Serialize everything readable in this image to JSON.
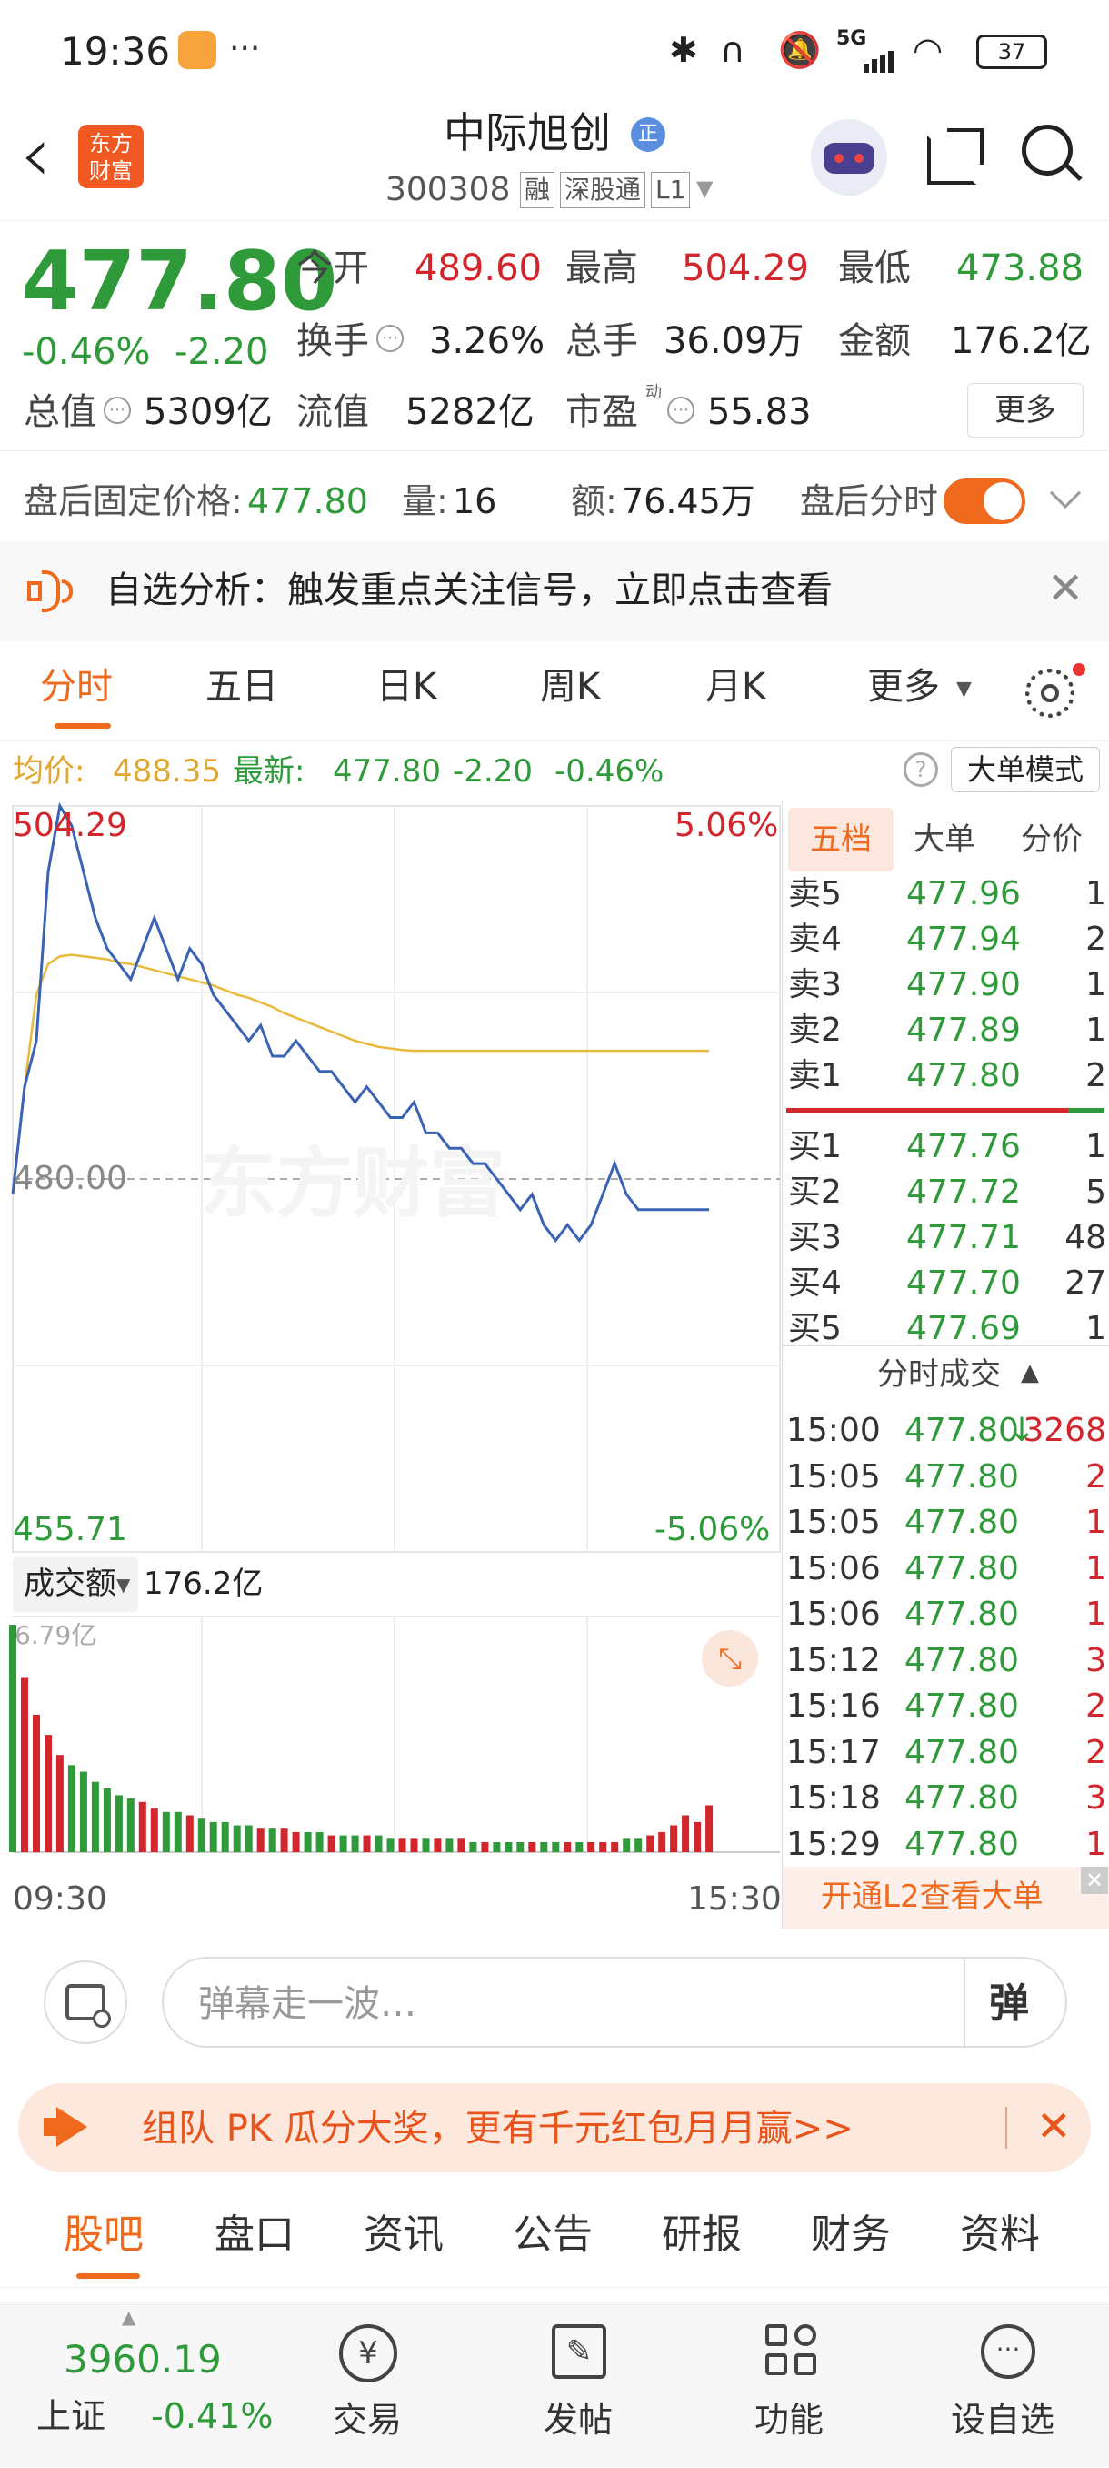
{
  "status_bar": {
    "time": "19:36",
    "more": "···",
    "signal": "5G",
    "battery": "37"
  },
  "header": {
    "back": "‹",
    "logo_line1": "东方",
    "logo_line2": "财富",
    "stock_name": "中际旭创",
    "badge": "正",
    "code": "300308",
    "tag_margin": "融",
    "tag_connect": "深股通",
    "tag_level": "L1"
  },
  "quote": {
    "price": "477.80",
    "change_pct": "-0.46%",
    "change": "-2.20",
    "open_label": "今开",
    "open": "489.60",
    "high_label": "最高",
    "high": "504.29",
    "low_label": "最低",
    "low": "473.88",
    "turnover_label": "换手",
    "turnover": "3.26%",
    "volume_label": "总手",
    "volume": "36.09万",
    "amount_label": "金额",
    "amount": "176.2亿",
    "mcap_label": "总值",
    "mcap": "5309亿",
    "float_label": "流值",
    "float": "5282亿",
    "pe_label": "市盈",
    "pe_sup": "动",
    "pe": "55.83",
    "more_button": "更多"
  },
  "after_hours": {
    "price_label": "盘后固定价格:",
    "price": "477.80",
    "vol_label": "量:",
    "vol": "16",
    "amt_label": "额:",
    "amt": "76.45万",
    "toggle_label": "盘后分时",
    "toggle_on": true
  },
  "notice": {
    "text": "自选分析：触发重点关注信号，立即点击查看"
  },
  "chart_tabs": [
    "分时",
    "五日",
    "日K",
    "周K",
    "月K",
    "更多"
  ],
  "active_chart_tab": 0,
  "info_line": {
    "avg_label": "均价:",
    "avg": "488.35",
    "latest_label": "最新:",
    "latest": "477.80",
    "change": "-2.20",
    "change_pct": "-0.46%",
    "help": "?",
    "mode_button": "大单模式"
  },
  "chart_labels": {
    "top_price": "504.29",
    "top_pct": "5.06%",
    "mid_price": "480.00",
    "bottom_price": "455.71",
    "bottom_pct": "-5.06%",
    "watermark": "东方财富",
    "amount_selector": "成交额",
    "amount_total": "176.2亿",
    "vol_max": "6.79亿",
    "time_start": "09:30",
    "time_end": "15:30"
  },
  "chart_data": {
    "type": "line",
    "x_range": [
      "09:30",
      "15:00"
    ],
    "ylim": [
      455.71,
      504.29
    ],
    "prev_close": 480.0,
    "series": [
      {
        "name": "",
        "color": "#3a63b5",
        "values": [
          479,
          486,
          489,
          500,
          504.29,
          503,
          500,
          497,
          495,
          494,
          493,
          495,
          497,
          495,
          493,
          495,
          494,
          492,
          491,
          490,
          489,
          490,
          488,
          488,
          489,
          488,
          487,
          487,
          486,
          485,
          486,
          485,
          484,
          484,
          485,
          483,
          483,
          482,
          482,
          481,
          481,
          480,
          479,
          478,
          479,
          477,
          476,
          477,
          476,
          477,
          479,
          481,
          479,
          478,
          478,
          478,
          478,
          478,
          478,
          478
        ]
      },
      {
        "name": "均价",
        "color": "#e8b93a",
        "values": [
          479,
          486,
          492,
          494,
          494.5,
          494.6,
          494.5,
          494.4,
          494.3,
          494.1,
          494,
          493.8,
          493.6,
          493.4,
          493.2,
          493,
          492.8,
          492.6,
          492.3,
          492,
          491.8,
          491.5,
          491.2,
          490.8,
          490.5,
          490.2,
          489.9,
          489.6,
          489.3,
          489,
          488.8,
          488.6,
          488.5,
          488.4,
          488.35,
          488.35,
          488.35,
          488.35,
          488.35,
          488.35,
          488.35,
          488.35,
          488.35,
          488.35,
          488.35,
          488.35,
          488.35,
          488.35,
          488.35,
          488.35,
          488.35,
          488.35,
          488.35,
          488.35,
          488.35,
          488.35,
          488.35,
          488.35,
          488.35,
          488.35
        ]
      }
    ],
    "volume_bars": {
      "unit": "亿",
      "max": 6.79,
      "values": [
        6.79,
        5.2,
        4.1,
        3.5,
        2.9,
        2.6,
        2.4,
        2.1,
        1.9,
        1.7,
        1.6,
        1.5,
        1.3,
        1.2,
        1.2,
        1.1,
        1.0,
        0.9,
        0.9,
        0.8,
        0.8,
        0.7,
        0.7,
        0.7,
        0.6,
        0.6,
        0.6,
        0.5,
        0.5,
        0.5,
        0.5,
        0.5,
        0.4,
        0.4,
        0.4,
        0.4,
        0.4,
        0.4,
        0.4,
        0.3,
        0.3,
        0.3,
        0.3,
        0.3,
        0.3,
        0.3,
        0.3,
        0.3,
        0.3,
        0.3,
        0.3,
        0.3,
        0.4,
        0.4,
        0.5,
        0.6,
        0.8,
        1.1,
        0.9,
        1.4
      ]
    }
  },
  "order_book": {
    "tabs": [
      "五档",
      "大单",
      "分价"
    ],
    "asks": [
      {
        "label": "卖5",
        "price": "477.96",
        "vol": "1"
      },
      {
        "label": "卖4",
        "price": "477.94",
        "vol": "2"
      },
      {
        "label": "卖3",
        "price": "477.90",
        "vol": "1"
      },
      {
        "label": "卖2",
        "price": "477.89",
        "vol": "1"
      },
      {
        "label": "卖1",
        "price": "477.80",
        "vol": "2"
      }
    ],
    "bids": [
      {
        "label": "买1",
        "price": "477.76",
        "vol": "1"
      },
      {
        "label": "买2",
        "price": "477.72",
        "vol": "5"
      },
      {
        "label": "买3",
        "price": "477.71",
        "vol": "48"
      },
      {
        "label": "买4",
        "price": "477.70",
        "vol": "27"
      },
      {
        "label": "买5",
        "price": "477.69",
        "vol": "1"
      }
    ],
    "trades_title": "分时成交",
    "trades": [
      {
        "time": "15:00",
        "price": "477.80",
        "vol": "3268",
        "arrow": "↓"
      },
      {
        "time": "15:05",
        "price": "477.80",
        "vol": "2",
        "arrow": ""
      },
      {
        "time": "15:05",
        "price": "477.80",
        "vol": "1",
        "arrow": ""
      },
      {
        "time": "15:06",
        "price": "477.80",
        "vol": "1",
        "arrow": ""
      },
      {
        "time": "15:06",
        "price": "477.80",
        "vol": "1",
        "arrow": ""
      },
      {
        "time": "15:12",
        "price": "477.80",
        "vol": "3",
        "arrow": ""
      },
      {
        "time": "15:16",
        "price": "477.80",
        "vol": "2",
        "arrow": ""
      },
      {
        "time": "15:17",
        "price": "477.80",
        "vol": "2",
        "arrow": ""
      },
      {
        "time": "15:18",
        "price": "477.80",
        "vol": "3",
        "arrow": ""
      },
      {
        "time": "15:29",
        "price": "477.80",
        "vol": "1",
        "arrow": ""
      }
    ],
    "l2_banner": "开通L2查看大单"
  },
  "danmu": {
    "placeholder": "弹幕走一波…",
    "send": "弹"
  },
  "promo": {
    "text": "组队 PK 瓜分大奖，更有千元红包月月赢>>"
  },
  "bottom_tabs": [
    "股吧",
    "盘口",
    "资讯",
    "公告",
    "研报",
    "财务",
    "资料"
  ],
  "active_bottom_tab": 0,
  "bottom_nav": {
    "index_value": "3960.19",
    "index_name": "上证",
    "index_change": "-0.41%",
    "items": [
      {
        "label": "交易",
        "icon": "yen-icon"
      },
      {
        "label": "发帖",
        "icon": "edit-icon"
      },
      {
        "label": "功能",
        "icon": "grid-icon"
      },
      {
        "label": "设自选",
        "icon": "more-icon"
      }
    ]
  },
  "colors": {
    "up": "#d3252c",
    "down": "#2f9a3a",
    "accent": "#f06a1e",
    "price_line": "#3a63b5",
    "avg_line": "#e8b93a"
  }
}
